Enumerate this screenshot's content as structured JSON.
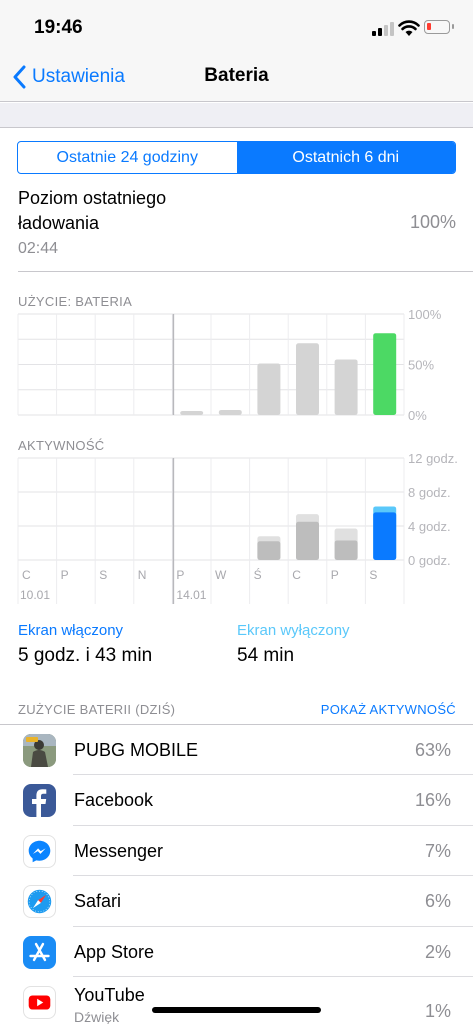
{
  "status_bar": {
    "time": "19:46"
  },
  "nav": {
    "back_label": "Ustawienia",
    "title": "Bateria"
  },
  "segmented": {
    "options": [
      "Ostatnie 24 godziny",
      "Ostatnich 6 dni"
    ],
    "selected_index": 1
  },
  "charge": {
    "title": "Poziom ostatniego ładowania",
    "time": "02:44",
    "value": "100%"
  },
  "colors": {
    "accent": "#0a7aff",
    "screen_off": "#5ac8fa",
    "battery_today": "#4cd964",
    "bar_gray": "#d4d4d4",
    "bar_dark": "#bdbdbd",
    "battery_low": "#ff3b30"
  },
  "chart_data": [
    {
      "type": "bar",
      "title": "UŻYCIE: BATERIA",
      "categories": [
        "C",
        "P",
        "S",
        "N",
        "P",
        "W",
        "Ś",
        "C",
        "P",
        "S"
      ],
      "values": [
        0,
        0,
        0,
        0,
        4,
        5,
        51,
        71,
        55,
        81
      ],
      "highlight_index": 9,
      "ylim": [
        0,
        100
      ],
      "y_ticks": [
        "100%",
        "50%",
        "0%"
      ]
    },
    {
      "type": "bar",
      "title": "AKTYWNOŚĆ",
      "categories": [
        "C",
        "P",
        "S",
        "N",
        "P",
        "W",
        "Ś",
        "C",
        "P",
        "S"
      ],
      "series": [
        {
          "values": [
            0,
            0,
            0,
            0,
            0,
            0,
            2.2,
            4.5,
            2.3,
            5.6
          ]
        },
        {
          "values": [
            0,
            0,
            0,
            0,
            0,
            0,
            0.6,
            0.9,
            1.4,
            0.7
          ]
        }
      ],
      "highlight_index": 9,
      "ylim": [
        0,
        12
      ],
      "y_ticks": [
        "12 godz.",
        "8 godz.",
        "4 godz.",
        "0 godz."
      ],
      "date_labels": [
        "10.01",
        "14.01"
      ]
    }
  ],
  "screen": {
    "on_label": "Ekran włączony",
    "on_value": "5 godz. i 43 min",
    "off_label": "Ekran wyłączony",
    "off_value": "54 min"
  },
  "usage": {
    "title": "ZUŻYCIE BATERII (DZIŚ)",
    "link": "POKAŻ AKTYWNOŚĆ",
    "apps": [
      {
        "name": "PUBG MOBILE",
        "percent": "63%",
        "icon": "pubg-icon"
      },
      {
        "name": "Facebook",
        "percent": "16%",
        "icon": "facebook-icon"
      },
      {
        "name": "Messenger",
        "percent": "7%",
        "icon": "messenger-icon"
      },
      {
        "name": "Safari",
        "percent": "6%",
        "icon": "safari-icon"
      },
      {
        "name": "App Store",
        "percent": "2%",
        "icon": "app-store-icon"
      },
      {
        "name": "YouTube",
        "sub": "Dźwięk",
        "percent": "1%",
        "icon": "youtube-icon"
      }
    ]
  }
}
